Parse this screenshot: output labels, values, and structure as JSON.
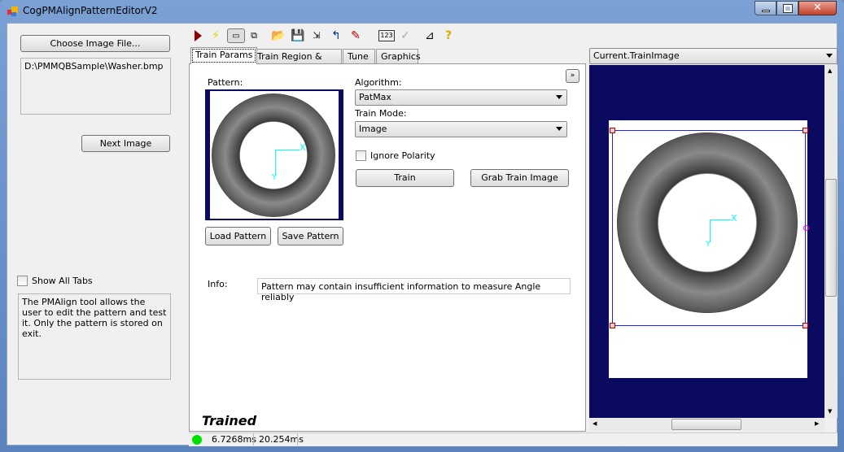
{
  "window": {
    "title": "CogPMAlignPatternEditorV2",
    "controls": [
      "minimize",
      "maximize",
      "close"
    ]
  },
  "left": {
    "choose_button": "Choose Image File...",
    "file_path": "D:\\PMMQBSample\\Washer.bmp",
    "next_button": "Next Image",
    "show_all_tabs": "Show All Tabs",
    "show_all_tabs_checked": false,
    "description": "The PMAlign tool allows the user to edit the pattern and test it. Only the pattern is stored on exit."
  },
  "toolbar": {
    "icons": [
      "run-icon",
      "electric-icon",
      "show-tool-display-icon",
      "floating-display-icon",
      "open-icon",
      "save-icon",
      "save-as-icon",
      "reset-icon",
      "local-icon",
      "results-icon",
      "disabled-check-icon",
      "measure-icon",
      "help-icon"
    ]
  },
  "tabs": [
    {
      "label": "Train Params",
      "active": true
    },
    {
      "label": "Train Region & Origin"
    },
    {
      "label": "Tune"
    },
    {
      "label": "Graphics"
    }
  ],
  "train": {
    "pattern_label": "Pattern:",
    "algorithm_label": "Algorithm:",
    "algorithm_value": "PatMax",
    "train_mode_label": "Train Mode:",
    "train_mode_value": "Image",
    "ignore_polarity": "Ignore Polarity",
    "ignore_polarity_checked": false,
    "train_button": "Train",
    "grab_button": "Grab Train Image",
    "load_button": "Load Pattern",
    "save_button": "Save Pattern",
    "info_label": "Info:",
    "info_value": "Pattern may contain insufficient information to measure Angle reliably",
    "state": "Trained",
    "pattern_axes": {
      "x": "X",
      "y": "Y"
    }
  },
  "status": {
    "indicator_color": "#00e000",
    "time1": "6.7268ms",
    "time2": "20.254ms"
  },
  "display": {
    "selector": "Current.TrainImage",
    "background": "#0a0a60",
    "axes": {
      "x": "X",
      "y": "Y"
    }
  }
}
